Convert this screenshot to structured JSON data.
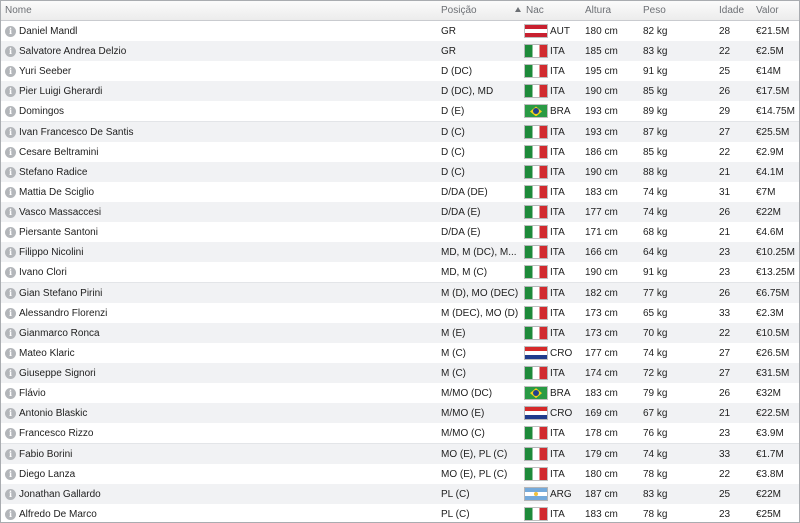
{
  "columns": {
    "name": "Nome",
    "position": "Posição",
    "nationality": "Nac",
    "height": "Altura",
    "weight": "Peso",
    "age": "Idade",
    "value": "Valor"
  },
  "sort": {
    "column": "nationality",
    "direction": "ascending"
  },
  "flag_colors": {
    "ITA": [
      "#1e8a3a",
      "#ffffff",
      "#d12b2f"
    ],
    "AUT": [
      "#c8202f",
      "#ffffff",
      "#c8202f"
    ],
    "CRO": [
      "#d52a2a",
      "#ffffff",
      "#1f3b8c"
    ],
    "ARG": [
      "#75aadb",
      "#ffffff",
      "#75aadb"
    ],
    "BRA": [
      "#2a9a45",
      "#f4d21a",
      "#23408e"
    ]
  },
  "players": [
    {
      "name": "Daniel Mandl",
      "position": "GR",
      "nat": "AUT",
      "height": "180 cm",
      "weight": "82 kg",
      "age": "28",
      "value": "€21.5M"
    },
    {
      "name": "Salvatore Andrea Delzio",
      "position": "GR",
      "nat": "ITA",
      "height": "185 cm",
      "weight": "83 kg",
      "age": "22",
      "value": "€2.5M"
    },
    {
      "name": "Yuri Seeber",
      "position": "D (DC)",
      "nat": "ITA",
      "height": "195 cm",
      "weight": "91 kg",
      "age": "25",
      "value": "€14M"
    },
    {
      "name": "Pier Luigi Gherardi",
      "position": "D (DC), MD",
      "nat": "ITA",
      "height": "190 cm",
      "weight": "85 kg",
      "age": "26",
      "value": "€17.5M"
    },
    {
      "name": "Domingos",
      "position": "D (E)",
      "nat": "BRA",
      "height": "193 cm",
      "weight": "89 kg",
      "age": "29",
      "value": "€14.75M"
    },
    {
      "name": "Ivan Francesco De Santis",
      "position": "D (C)",
      "nat": "ITA",
      "height": "193 cm",
      "weight": "87 kg",
      "age": "27",
      "value": "€25.5M"
    },
    {
      "name": "Cesare Beltramini",
      "position": "D (C)",
      "nat": "ITA",
      "height": "186 cm",
      "weight": "85 kg",
      "age": "22",
      "value": "€2.9M"
    },
    {
      "name": "Stefano Radice",
      "position": "D (C)",
      "nat": "ITA",
      "height": "190 cm",
      "weight": "88 kg",
      "age": "21",
      "value": "€4.1M"
    },
    {
      "name": "Mattia De Sciglio",
      "position": "D/DA (DE)",
      "nat": "ITA",
      "height": "183 cm",
      "weight": "74 kg",
      "age": "31",
      "value": "€7M"
    },
    {
      "name": "Vasco Massaccesi",
      "position": "D/DA (E)",
      "nat": "ITA",
      "height": "177 cm",
      "weight": "74 kg",
      "age": "26",
      "value": "€22M"
    },
    {
      "name": "Piersante Santoni",
      "position": "D/DA (E)",
      "nat": "ITA",
      "height": "171 cm",
      "weight": "68 kg",
      "age": "21",
      "value": "€4.6M"
    },
    {
      "name": "Filippo Nicolini",
      "position": "MD, M (DC), M...",
      "nat": "ITA",
      "height": "166 cm",
      "weight": "64 kg",
      "age": "23",
      "value": "€10.25M"
    },
    {
      "name": "Ivano Clori",
      "position": "MD, M (C)",
      "nat": "ITA",
      "height": "190 cm",
      "weight": "91 kg",
      "age": "23",
      "value": "€13.25M"
    },
    {
      "name": "Gian Stefano Pirini",
      "position": "M (D), MO (DEC)",
      "nat": "ITA",
      "height": "182 cm",
      "weight": "77 kg",
      "age": "26",
      "value": "€6.75M"
    },
    {
      "name": "Alessandro Florenzi",
      "position": "M (DEC), MO (D)",
      "nat": "ITA",
      "height": "173 cm",
      "weight": "65 kg",
      "age": "33",
      "value": "€2.3M"
    },
    {
      "name": "Gianmarco Ronca",
      "position": "M (E)",
      "nat": "ITA",
      "height": "173 cm",
      "weight": "70 kg",
      "age": "22",
      "value": "€10.5M"
    },
    {
      "name": "Mateo Klaric",
      "position": "M (C)",
      "nat": "CRO",
      "height": "177 cm",
      "weight": "74 kg",
      "age": "27",
      "value": "€26.5M"
    },
    {
      "name": "Giuseppe Signori",
      "position": "M (C)",
      "nat": "ITA",
      "height": "174 cm",
      "weight": "72 kg",
      "age": "27",
      "value": "€31.5M"
    },
    {
      "name": "Flávio",
      "position": "M/MO (DC)",
      "nat": "BRA",
      "height": "183 cm",
      "weight": "79 kg",
      "age": "26",
      "value": "€32M"
    },
    {
      "name": "Antonio Blaskic",
      "position": "M/MO (E)",
      "nat": "CRO",
      "height": "169 cm",
      "weight": "67 kg",
      "age": "21",
      "value": "€22.5M"
    },
    {
      "name": "Francesco Rizzo",
      "position": "M/MO (C)",
      "nat": "ITA",
      "height": "178 cm",
      "weight": "76 kg",
      "age": "23",
      "value": "€3.9M"
    },
    {
      "name": "Fabio Borini",
      "position": "MO (E), PL (C)",
      "nat": "ITA",
      "height": "179 cm",
      "weight": "74 kg",
      "age": "33",
      "value": "€1.7M"
    },
    {
      "name": "Diego Lanza",
      "position": "MO (E), PL (C)",
      "nat": "ITA",
      "height": "180 cm",
      "weight": "78 kg",
      "age": "22",
      "value": "€3.8M"
    },
    {
      "name": "Jonathan Gallardo",
      "position": "PL (C)",
      "nat": "ARG",
      "height": "187 cm",
      "weight": "83 kg",
      "age": "25",
      "value": "€22M"
    },
    {
      "name": "Alfredo De Marco",
      "position": "PL (C)",
      "nat": "ITA",
      "height": "183 cm",
      "weight": "78 kg",
      "age": "23",
      "value": "€25M"
    }
  ]
}
